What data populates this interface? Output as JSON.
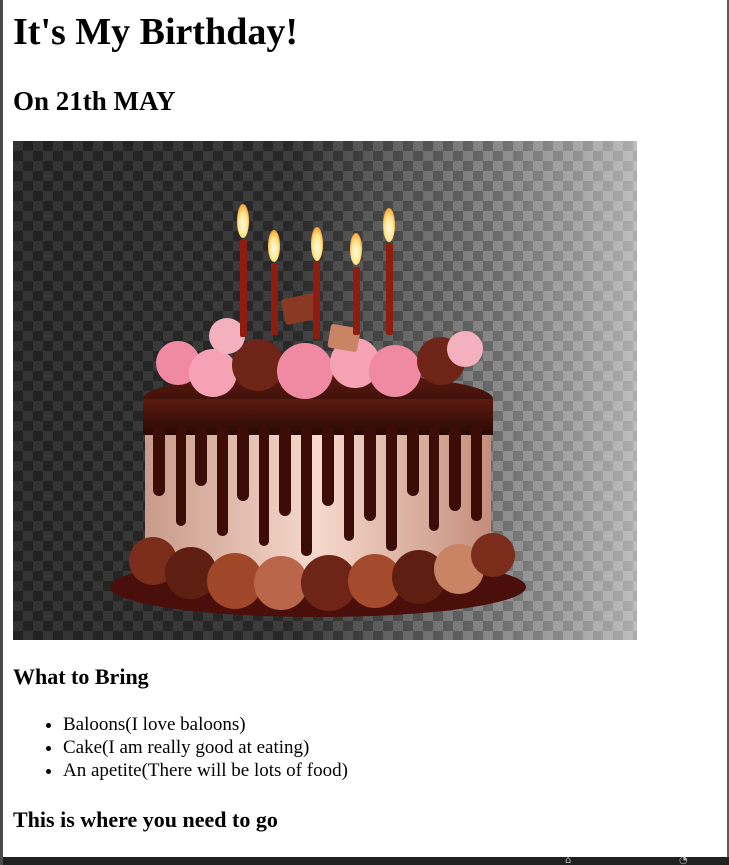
{
  "heading": "It's My Birthday!",
  "date": "On 21th MAY",
  "image": {
    "subject": "birthday cake with five lit candles",
    "icon": "cake-image"
  },
  "bring_section": {
    "title": "What to Bring",
    "items": [
      "Baloons(I love baloons)",
      "Cake(I am really good at eating)",
      "An apetite(There will be lots of food)"
    ]
  },
  "directions_title": "This is where you need to go",
  "colors": {
    "frame_border": "#4a4a4a",
    "taskbar": "#202020",
    "chocolate": "#3b0d06",
    "frosting_pink": "#f08aa3",
    "cake_cream": "#f3cfc0"
  }
}
